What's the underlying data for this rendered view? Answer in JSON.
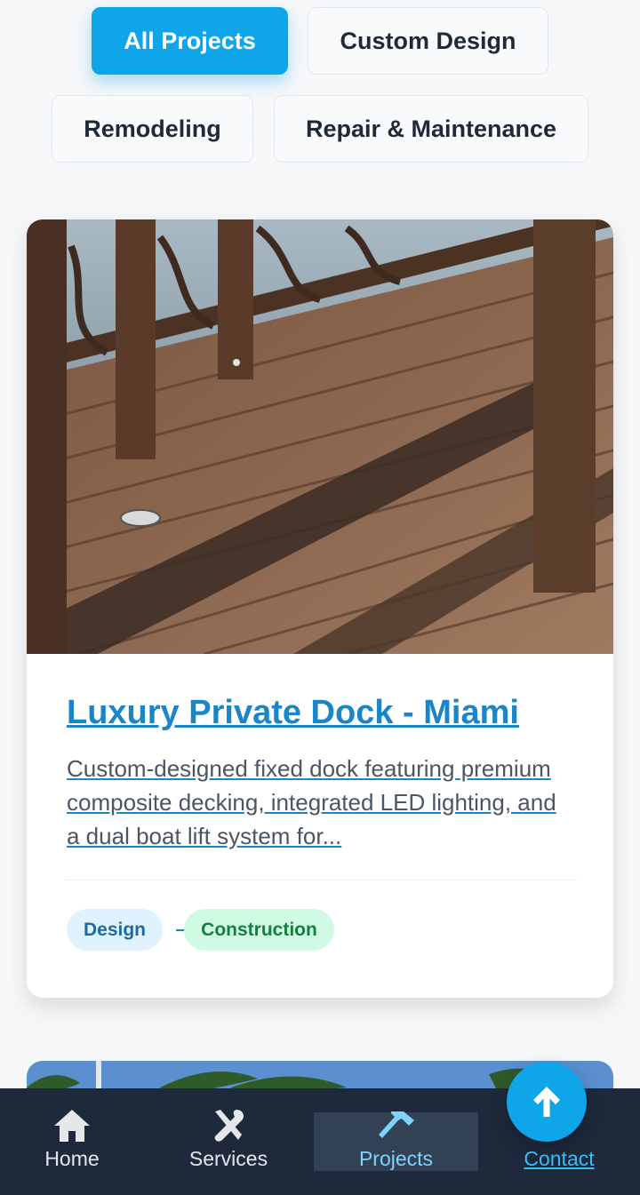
{
  "filters": [
    {
      "label": "All Projects",
      "active": true
    },
    {
      "label": "Custom Design",
      "active": false
    },
    {
      "label": "Remodeling",
      "active": false
    },
    {
      "label": "Repair & Maintenance",
      "active": false
    }
  ],
  "project": {
    "title": "Luxury Private Dock - Miami",
    "description": "Custom-designed fixed dock featuring premium composite decking, integrated LED lighting, and a dual boat lift system for...",
    "tags": [
      "Design",
      "Construction"
    ]
  },
  "nav": {
    "home": "Home",
    "services": "Services",
    "projects": "Projects",
    "contact": "Contact"
  },
  "colors": {
    "accent": "#0ea5e9",
    "link": "#1a86c7",
    "nav_bg": "#1e293b"
  },
  "icons": [
    "home-icon",
    "tools-icon",
    "hammer-icon",
    "arrow-up-icon"
  ]
}
